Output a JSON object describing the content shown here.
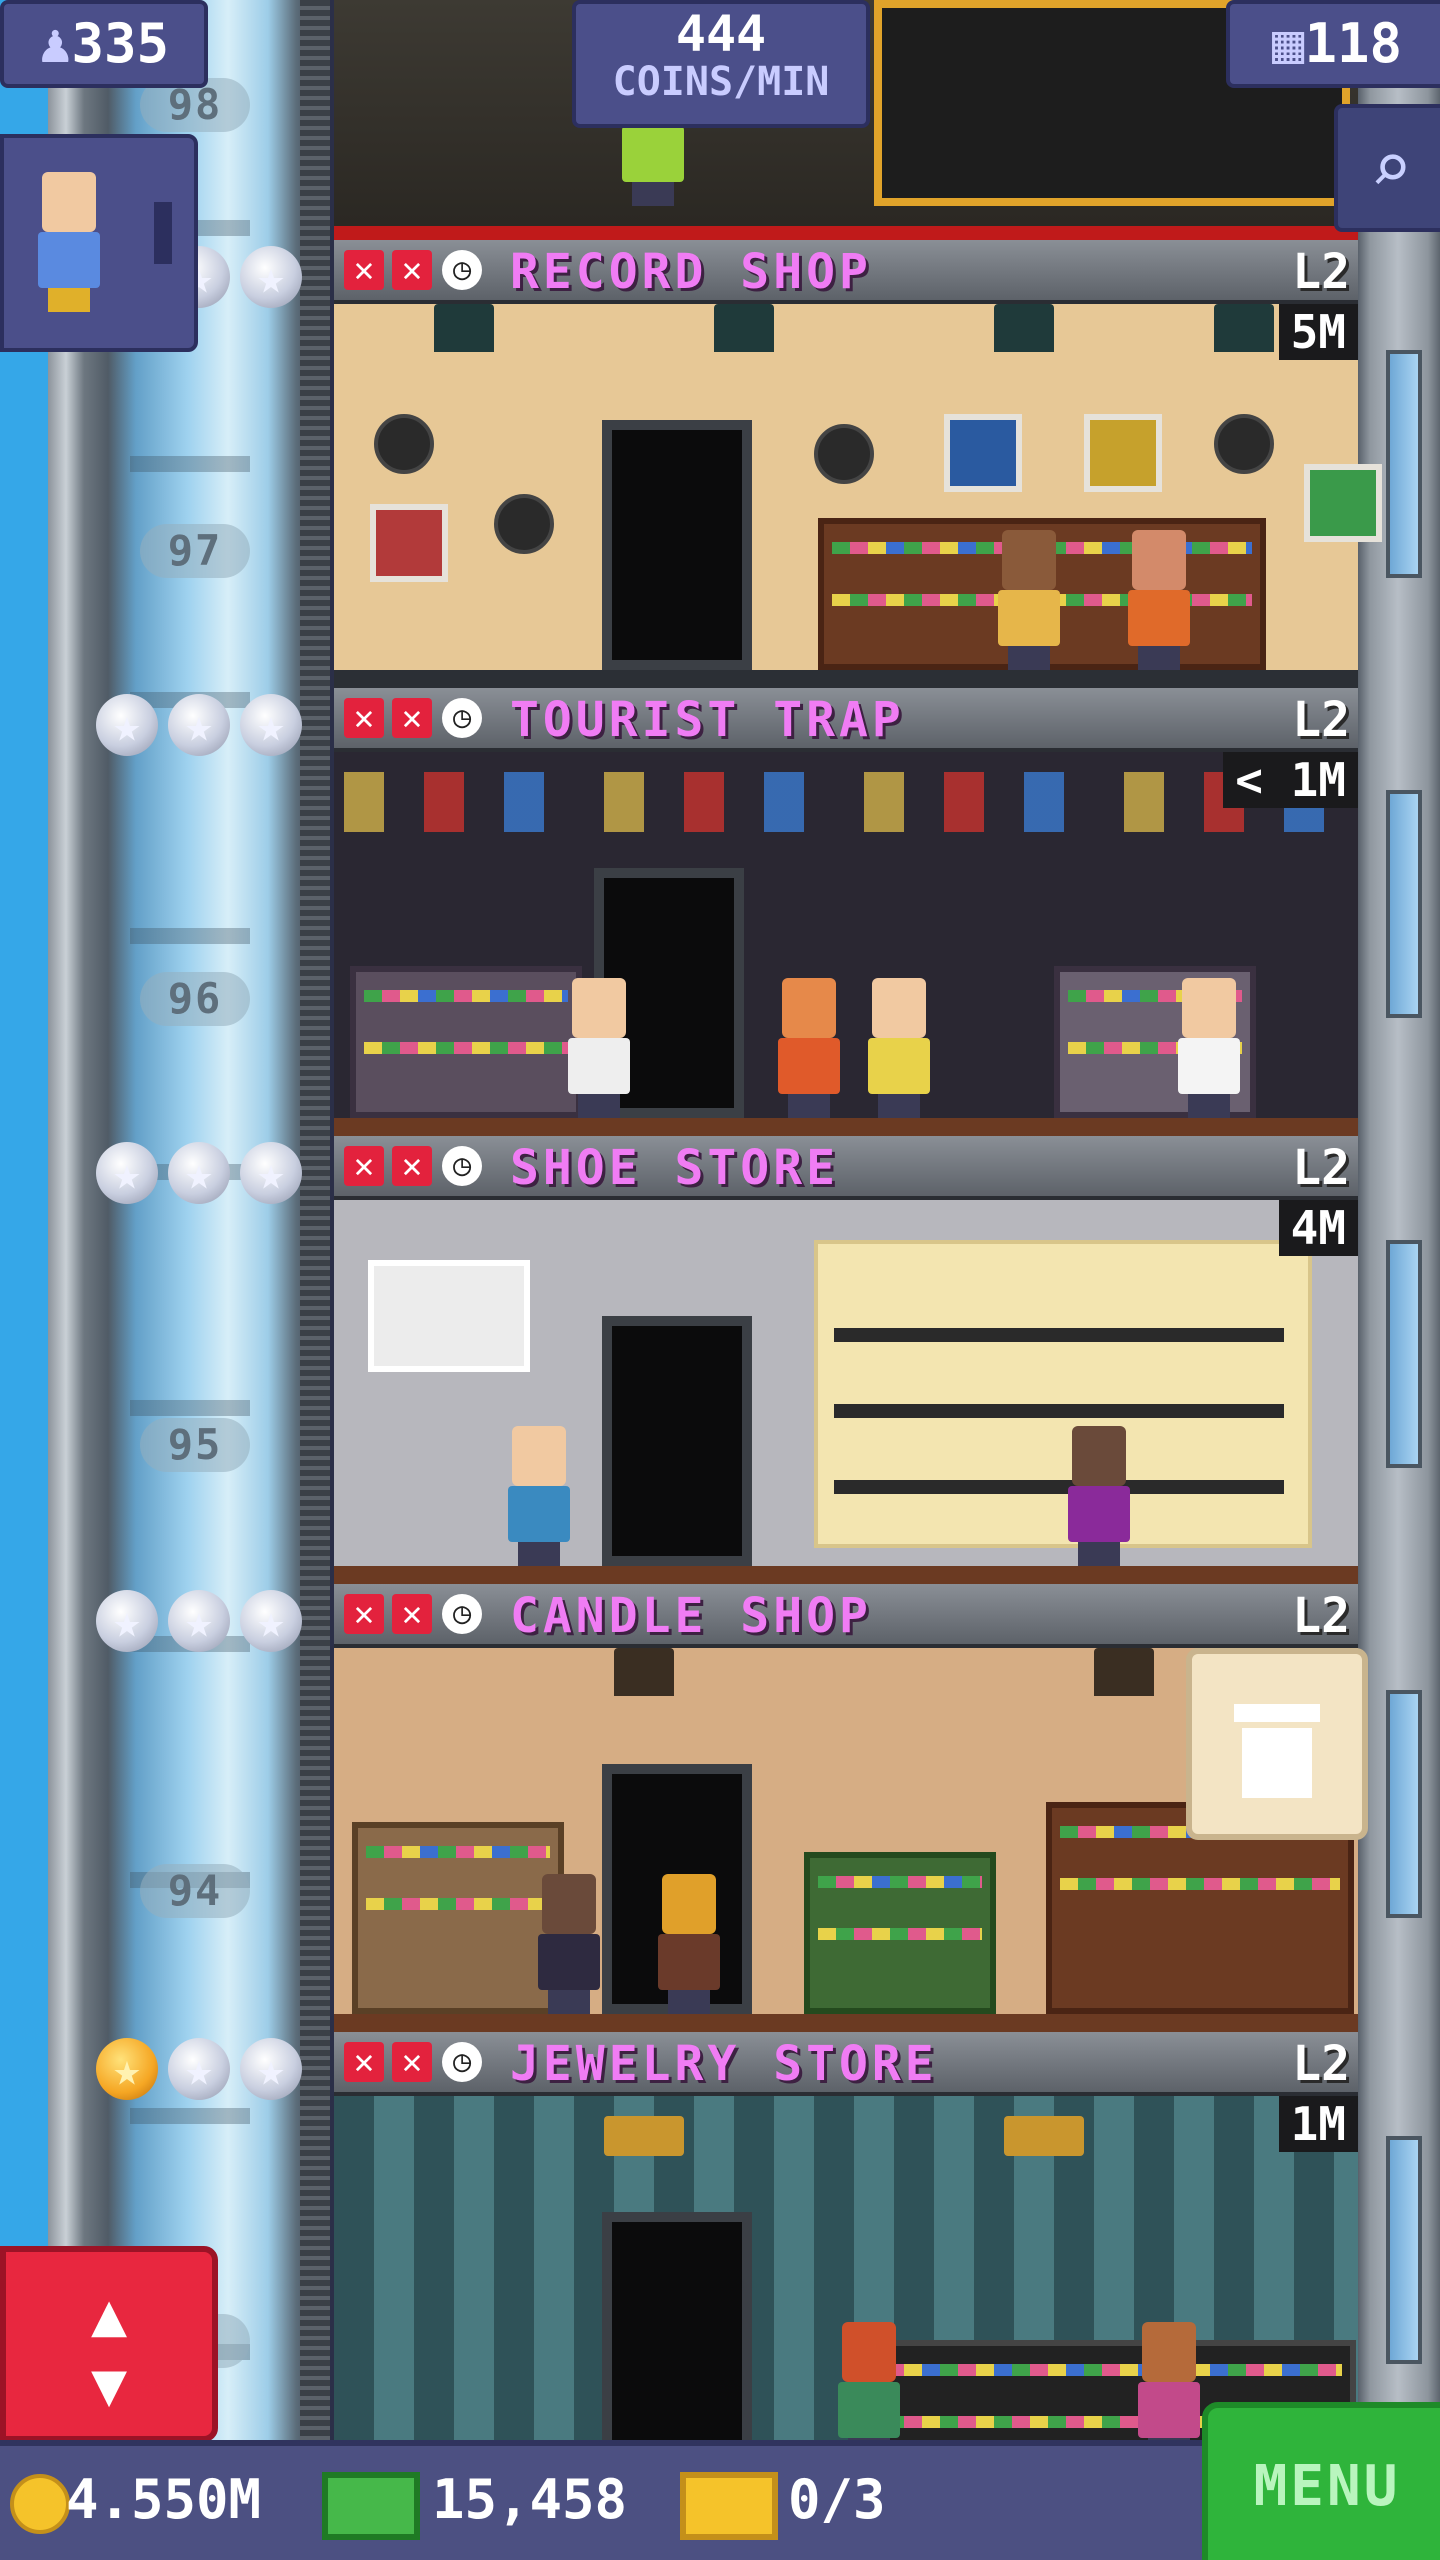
{
  "hud": {
    "population": "335",
    "coins_per_min_value": "444",
    "coins_per_min_unit": "COINS/MIN",
    "floors_count": "118",
    "search_icon": "magnifier-icon",
    "population_icon": "person-icon",
    "floors_icon": "building-icon"
  },
  "shaft_floor_numbers": [
    {
      "label": "98"
    },
    {
      "label": "97"
    },
    {
      "label": "96"
    },
    {
      "label": "95"
    },
    {
      "label": "94"
    },
    {
      "label": "93"
    }
  ],
  "floors": [
    {
      "name": "RECORD SHOP",
      "level": "L2",
      "time": "5M",
      "stars": [
        false,
        false,
        false
      ]
    },
    {
      "name": "TOURIST TRAP",
      "level": "L2",
      "time": "< 1M",
      "stars": [
        false,
        false,
        false
      ]
    },
    {
      "name": "SHOE STORE",
      "level": "L2",
      "time": "4M",
      "stars": [
        false,
        false,
        false
      ]
    },
    {
      "name": "CANDLE SHOP",
      "level": "L2",
      "time": "",
      "stars": [
        false,
        false,
        false
      ]
    },
    {
      "name": "JEWELRY STORE",
      "level": "L2",
      "time": "1M",
      "stars": [
        true,
        false,
        false
      ]
    }
  ],
  "status_icons": {
    "missing_stock": "x-icon",
    "timer": "clock-icon"
  },
  "bottom_bar": {
    "coins": "4.550M",
    "bux": "15,458",
    "tickets": "0/3",
    "menu_label": "MENU"
  },
  "colors": {
    "floor_name": "#f07cf4",
    "menu_green": "#2fb43b",
    "elevator_red": "#e8273f",
    "hud_purple": "#4b4f8a",
    "gold_star": "#f5a623"
  }
}
